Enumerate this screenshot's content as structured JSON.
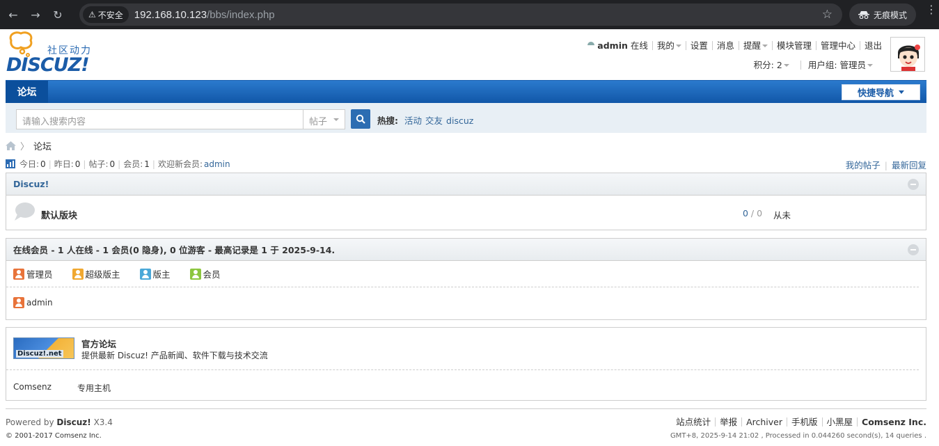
{
  "browser": {
    "security_label": "不安全",
    "url_host": "192.168.10.123",
    "url_path": "/bbs/index.php",
    "incognito_label": "无痕模式"
  },
  "brand": {
    "tagline": "社区动力",
    "wordmark": "DISCUZ!",
    "primary_color": "#1b5ca8"
  },
  "user_bar": {
    "username": "admin",
    "status": "在线",
    "links": [
      "我的",
      "设置",
      "消息",
      "提醒",
      "模块管理",
      "管理中心",
      "退出"
    ],
    "points_label": "积分: 2",
    "group_label": "用户组: 管理员"
  },
  "nav": {
    "tab_forum": "论坛",
    "quick_nav": "快捷导航"
  },
  "search": {
    "placeholder": "请输入搜索内容",
    "scope": "帖子",
    "hot_label": "热搜:",
    "hot_terms": [
      "活动",
      "交友",
      "discuz"
    ]
  },
  "breadcrumb": {
    "current": "论坛"
  },
  "stats": {
    "today_label": "今日:",
    "today": "0",
    "yesterday_label": "昨日:",
    "yesterday": "0",
    "posts_label": "帖子:",
    "posts": "0",
    "members_label": "会员:",
    "members": "1",
    "newest_label": "欢迎新会员:",
    "newest": "admin",
    "my_posts": "我的帖子",
    "latest_replies": "最新回复"
  },
  "category": {
    "title": "Discuz!",
    "forum_name": "默认版块",
    "threads": "0",
    "posts": "0",
    "last_post": "从未"
  },
  "online": {
    "title": "在线会员 - 1 人在线 - 1 会员(0 隐身), 0 位游客 - 最高记录是 1 于 2025-9-14.",
    "legend": [
      {
        "label": "管理员",
        "color": "#e8733a"
      },
      {
        "label": "超级版主",
        "color": "#f0a830"
      },
      {
        "label": "版主",
        "color": "#4aa8d8"
      },
      {
        "label": "会员",
        "color": "#8cc63f"
      }
    ],
    "users": [
      "admin"
    ]
  },
  "links": {
    "logo_text": "Discuz!.net",
    "title": "官方论坛",
    "desc": "提供最新 Discuz! 产品新闻、软件下载与技术交流",
    "text_links": [
      "Comsenz",
      "专用主机"
    ]
  },
  "footer": {
    "powered_prefix": "Powered by",
    "powered_brand": "Discuz!",
    "version": "X3.4",
    "copyright": "© 2001-2017 Comsenz Inc.",
    "links": [
      "站点统计",
      "举报",
      "Archiver",
      "手机版",
      "小黑屋",
      "Comsenz Inc."
    ],
    "gmt": "GMT+8, 2025-9-14 21:02 , Processed in 0.044260 second(s), 14 queries ."
  }
}
